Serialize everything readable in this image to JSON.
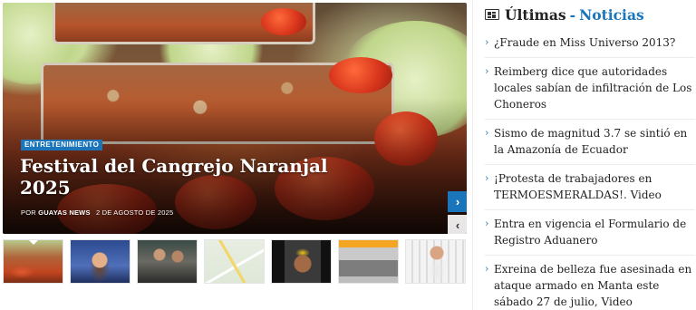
{
  "colors": {
    "accent": "#1a75bb",
    "text": "#222222",
    "divider": "#ececec"
  },
  "hero": {
    "category": "ENTRETENIMIENTO",
    "title": "Festival del Cangrejo Naranjal 2025",
    "byline_prefix": "POR",
    "author": "GUAYAS NEWS",
    "date": "2 DE AGOSTO DE 2025",
    "next_icon": "chevron-right-icon",
    "prev_icon": "chevron-left-icon",
    "next_glyph": "›",
    "prev_glyph": "‹"
  },
  "thumbnails": [
    {
      "name": "thumb-crab-festival",
      "active": true
    },
    {
      "name": "thumb-miss-universe"
    },
    {
      "name": "thumb-group-photo"
    },
    {
      "name": "thumb-map"
    },
    {
      "name": "thumb-press-interview"
    },
    {
      "name": "thumb-office-queue"
    },
    {
      "name": "thumb-beauty-queen"
    }
  ],
  "news": {
    "icon": "newspaper-icon",
    "title_first": "Últimas",
    "title_dash": "-",
    "title_second": "Noticias",
    "bullet": "›",
    "items": [
      "¿Fraude en Miss Universo 2013?",
      "Reimberg dice que autoridades locales sabían de infiltración de Los Choneros",
      "Sismo de magnitud 3.7 se sintió en la Amazonía de Ecuador",
      "¡Protesta de trabajadores en TERMOESMERALDAS!. Video",
      "Entra en vigencia el Formulario de Registro Aduanero",
      "Exreina de belleza fue asesinada en ataque armado en Manta este sábado 27 de julio, Video"
    ]
  }
}
